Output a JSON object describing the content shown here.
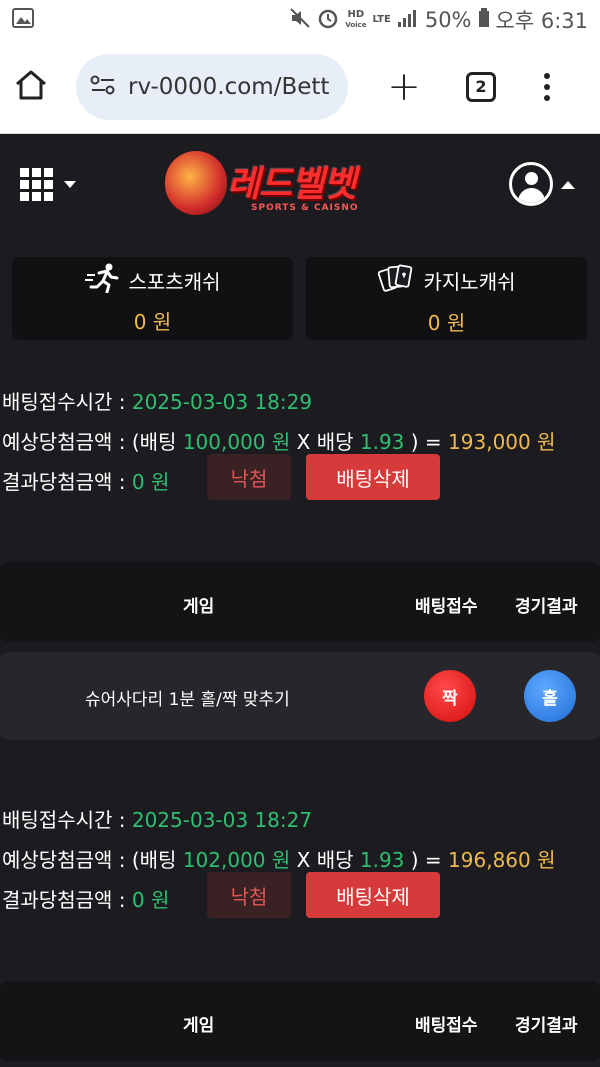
{
  "status_bar": {
    "hd_label": "HD",
    "voice_label": "Voice",
    "lte_label": "LTE",
    "battery": "50%",
    "time": "오후 6:31"
  },
  "browser": {
    "url": "rv-0000.com/Bett",
    "tab_count": "2"
  },
  "site": {
    "logo_text": "레드벨벳",
    "logo_sub": "SPORTS & CAISNO"
  },
  "balances": [
    {
      "label": "스포츠캐쉬",
      "amount": "0 원"
    },
    {
      "label": "카지노캐쉬",
      "amount": "0 원"
    }
  ],
  "labels": {
    "bet_time": "배팅접수시간 : ",
    "expected_prefix": "예상당첨금액 : (배팅 ",
    "expected_x": " X 배당 ",
    "expected_eq": " ) = ",
    "result": "결과당첨금액 : ",
    "lost_button": "낙첨",
    "delete_button": "배팅삭제",
    "col_game": "게임",
    "col_bet": "배팅접수",
    "col_result": "경기결과"
  },
  "bets": [
    {
      "time": "2025-03-03 18:29",
      "stake": "100,000 원",
      "odds": "1.93",
      "payout": "193,000 원",
      "result_amount": "0 원",
      "game": "슈어사다리 1분 홀/짝 맞추기",
      "pick": "짝",
      "outcome": "홀"
    },
    {
      "time": "2025-03-03 18:27",
      "stake": "102,000 원",
      "odds": "1.93",
      "payout": "196,860 원",
      "result_amount": "0 원"
    }
  ]
}
